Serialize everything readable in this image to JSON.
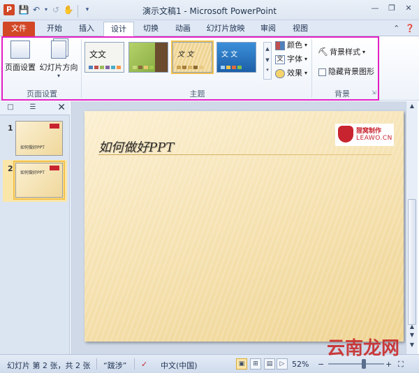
{
  "app": {
    "window_title": "演示文稿1 - Microsoft PowerPoint",
    "icon_letter": "P"
  },
  "quick_access": {
    "items": [
      "save-icon",
      "undo-icon",
      "undo-dropdown-icon",
      "redo-icon",
      "touch-icon",
      "customize-icon"
    ]
  },
  "tabs": [
    "文件",
    "开始",
    "插入",
    "设计",
    "切换",
    "动画",
    "幻灯片放映",
    "审阅",
    "视图"
  ],
  "active_tab": "设计",
  "ribbon": {
    "page_setup": {
      "page_setup_label": "页面设置",
      "orientation_label": "幻灯片方向",
      "group_label": "页面设置"
    },
    "themes": {
      "group_label": "主题",
      "theme_text": "文文",
      "theme_text_small": "文 文",
      "colors_label": "颜色",
      "fonts_label": "字体",
      "effects_label": "效果"
    },
    "background": {
      "group_label": "背景",
      "styles_label": "背景样式",
      "hide_graphics_label": "隐藏背景图形"
    }
  },
  "slides_panel": {
    "slides": [
      {
        "number": "1",
        "title": "如何做好PPT"
      },
      {
        "number": "2",
        "title": "如何做好PPT"
      }
    ],
    "selected": 2
  },
  "slide": {
    "title": "如何做好PPT",
    "logo_line1": "狸窝制作",
    "logo_line2": "LEAWO.CN"
  },
  "status": {
    "slide_info": "幻灯片 第 2 张，共 2 张",
    "theme_name": "“跋涉”",
    "language": "中文(中国)",
    "zoom": "52%"
  },
  "watermark": "云南龙网",
  "colors": {
    "file_tab": "#d24726",
    "highlight_box": "#e21fc4",
    "selected_gold": "#f2c24b"
  }
}
